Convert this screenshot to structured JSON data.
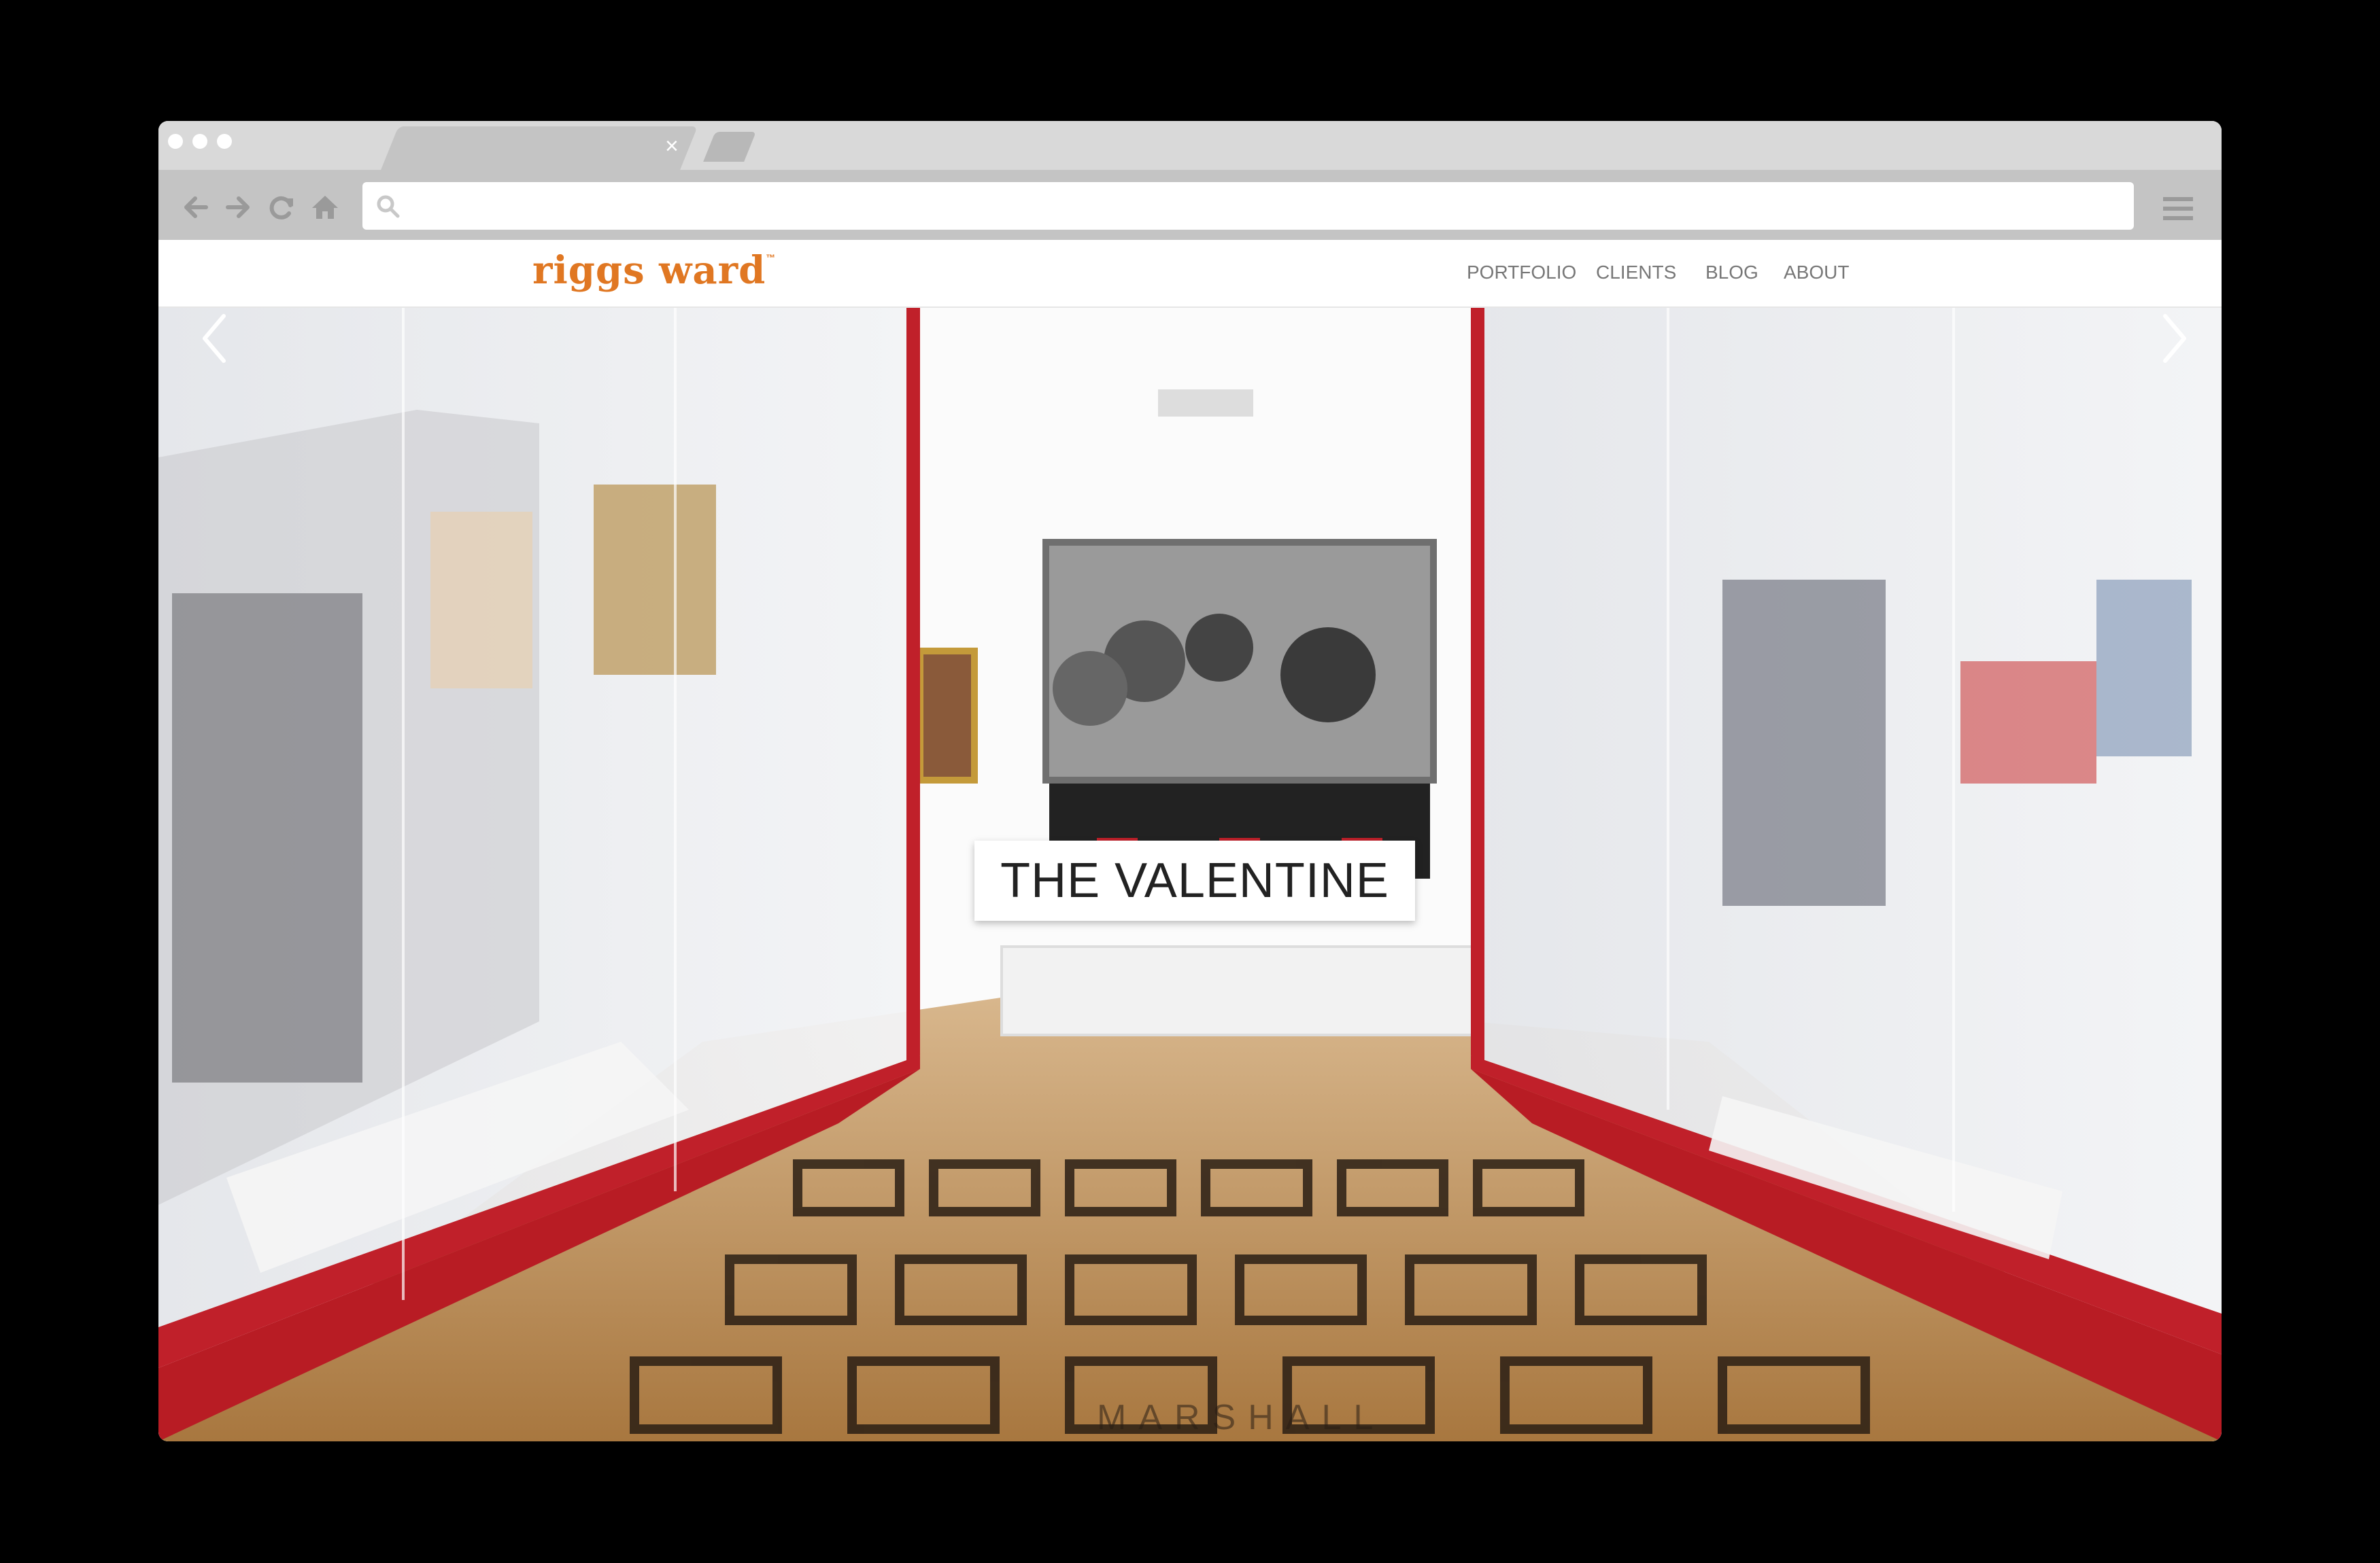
{
  "browser": {
    "tab_close": "×",
    "address_value": "",
    "nav_icons": [
      "back-arrow-icon",
      "forward-arrow-icon",
      "reload-icon",
      "home-icon"
    ]
  },
  "site": {
    "logo": "riggs ward",
    "logo_tm": "™",
    "nav": [
      "PORTFOLIO",
      "CLIENTS",
      "BLOG",
      "ABOUT"
    ],
    "accent_color": "#e07722"
  },
  "hero": {
    "caption": "THE VALENTINE",
    "floor_text": "MARSHALL",
    "prev_icon": "chevron-left-icon",
    "next_icon": "chevron-right-icon"
  }
}
